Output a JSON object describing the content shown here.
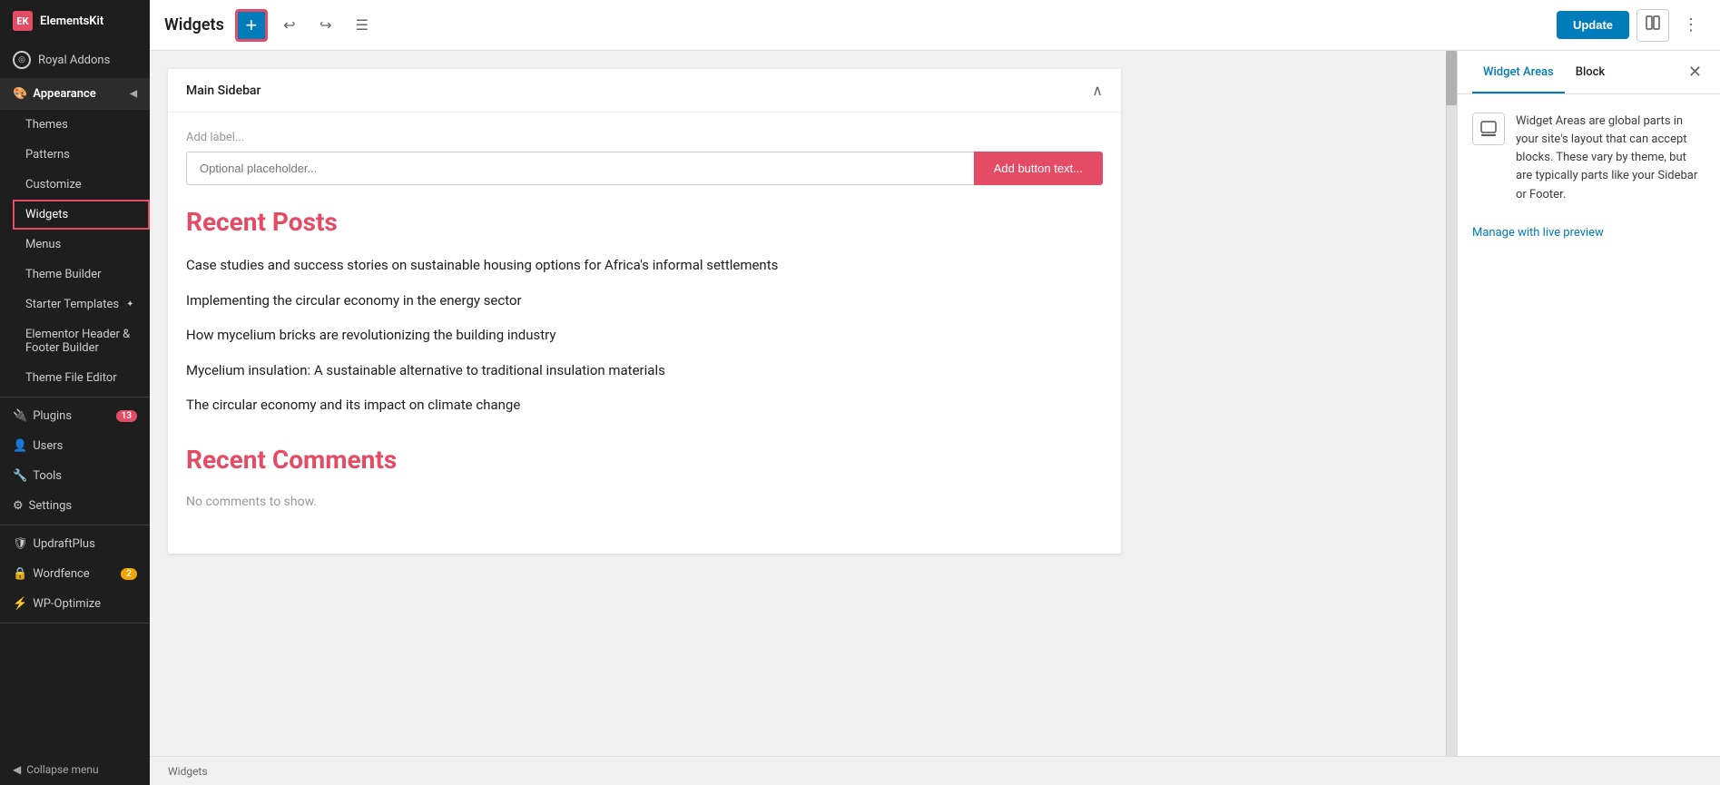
{
  "sidebar": {
    "elementskit_label": "ElementsKit",
    "royal_addons_label": "Royal Addons",
    "appearance_label": "Appearance",
    "appearance_chevron": "◀",
    "items": [
      {
        "id": "themes",
        "label": "Themes",
        "icon": ""
      },
      {
        "id": "patterns",
        "label": "Patterns",
        "icon": ""
      },
      {
        "id": "customize",
        "label": "Customize",
        "icon": ""
      },
      {
        "id": "widgets",
        "label": "Widgets",
        "icon": "",
        "active": true
      },
      {
        "id": "menus",
        "label": "Menus",
        "icon": ""
      },
      {
        "id": "theme-builder",
        "label": "Theme Builder",
        "icon": ""
      },
      {
        "id": "starter-templates",
        "label": "Starter Templates",
        "icon": "✦"
      },
      {
        "id": "elementor-header",
        "label": "Elementor Header & Footer Builder",
        "icon": ""
      },
      {
        "id": "theme-file-editor",
        "label": "Theme File Editor",
        "icon": ""
      }
    ],
    "plugins_label": "Plugins",
    "plugins_badge": "13",
    "users_label": "Users",
    "tools_label": "Tools",
    "settings_label": "Settings",
    "updraftplus_label": "UpdraftPlus",
    "wordfence_label": "Wordfence",
    "wordfence_badge": "2",
    "wp_optimize_label": "WP-Optimize",
    "collapse_label": "Collapse menu"
  },
  "toolbar": {
    "title": "Widgets",
    "add_btn_label": "+",
    "update_label": "Update"
  },
  "widget_areas_tab": "Widget Areas",
  "block_tab": "Block",
  "right_panel": {
    "close_label": "✕",
    "info_text": "Widget Areas are global parts in your site's layout that can accept blocks. These vary by theme, but are typically parts like your Sidebar or Footer.",
    "manage_link": "Manage with live preview"
  },
  "main_sidebar": {
    "panel_title": "Main Sidebar",
    "add_label": "Add label...",
    "placeholder_text": "Optional placeholder...",
    "add_button_text": "Add button text...",
    "section1_title": "Recent Posts",
    "posts": [
      "Case studies and success stories on sustainable housing options for Africa's informal settlements",
      "Implementing the circular economy in the energy sector",
      "How mycelium bricks are revolutionizing the building industry",
      "Mycelium insulation: A sustainable alternative to traditional insulation materials",
      "The circular economy and its impact on climate change"
    ],
    "section2_title": "Recent Comments",
    "no_comments": "No comments to show."
  },
  "footer": {
    "label": "Widgets"
  }
}
